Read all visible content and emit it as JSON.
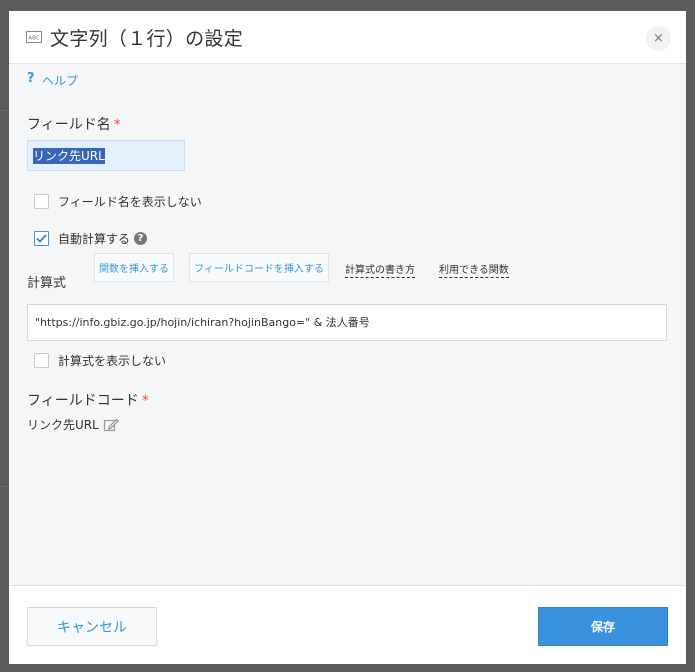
{
  "dialog": {
    "title": "文字列（１行）の設定",
    "title_icon": "single-line-text-icon",
    "close_icon": "close-icon",
    "close_glyph": "×"
  },
  "help": {
    "icon_glyph": "?",
    "label": "ヘルプ"
  },
  "field_name": {
    "label": "フィールド名",
    "required_mark": "*",
    "value": "リンク先URL",
    "hide_label": "フィールド名を表示しない",
    "hide_checked": false
  },
  "auto_calc": {
    "label": "自動計算する",
    "checked": true,
    "info_glyph": "?"
  },
  "formula": {
    "label": "計算式",
    "insert_function": "関数を挿入する",
    "insert_field_code": "フィールドコードを挿入する",
    "how_to_write": "計算式の書き方",
    "available_functions": "利用できる関数",
    "value": "\"https://info.gbiz.go.jp/hojin/ichiran?hojinBango=\" & 法人番号",
    "hide_label": "計算式を表示しない",
    "hide_checked": false
  },
  "field_code": {
    "label": "フィールドコード",
    "required_mark": "*",
    "value": "リンク先URL"
  },
  "footer": {
    "cancel_label": "キャンセル",
    "save_label": "保存"
  },
  "colors": {
    "accent": "#3498db",
    "required": "#e74c3c",
    "save_bg": "#3a91dd",
    "selection": "#3a66b8"
  }
}
